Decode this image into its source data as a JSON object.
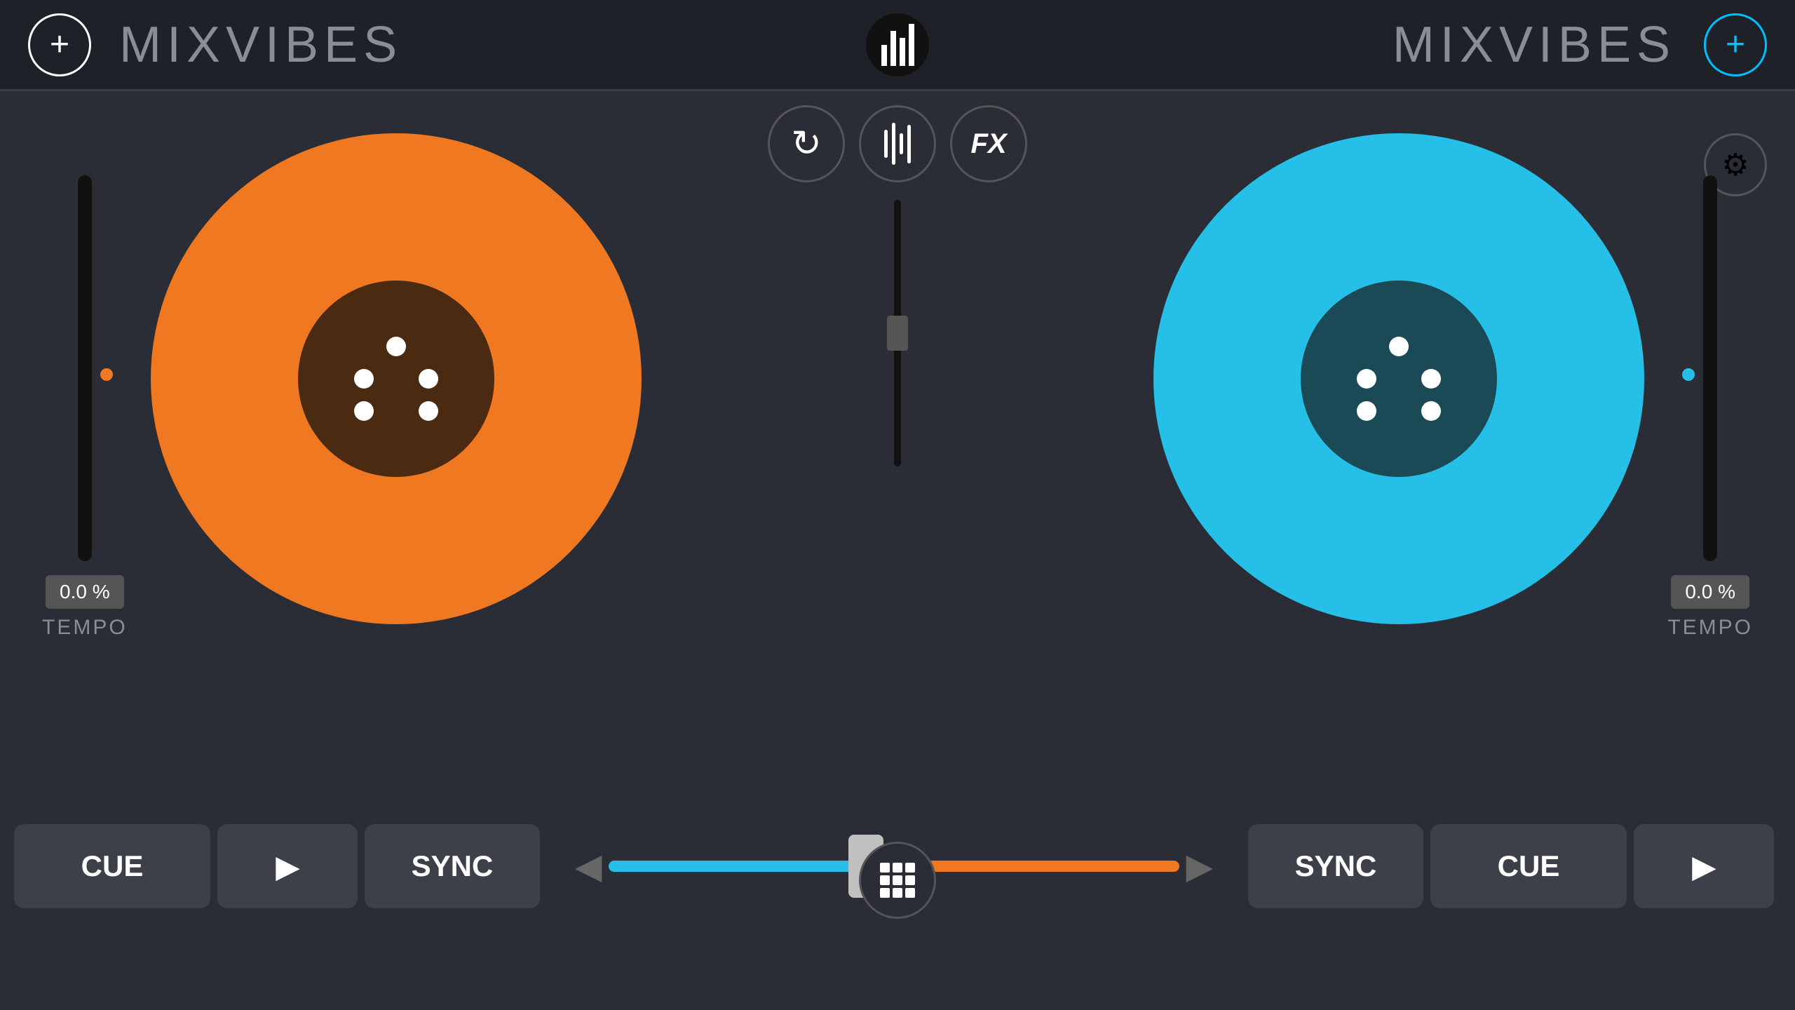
{
  "header": {
    "left_add_label": "+",
    "right_add_label": "+",
    "left_title": "MIXVIBES",
    "right_title": "MIXVIBES"
  },
  "mixer": {
    "fx_label": "FX"
  },
  "left_deck": {
    "tempo_value": "0.0 %",
    "tempo_label": "TEMPO",
    "color": "#f07820"
  },
  "right_deck": {
    "tempo_value": "0.0 %",
    "tempo_label": "TEMPO",
    "color": "#26bfe8"
  },
  "bottom": {
    "cue_left": "CUE",
    "play_left": "▶",
    "sync_left": "SYNC",
    "sync_right": "SYNC",
    "cue_right": "CUE",
    "play_right": "▶"
  }
}
